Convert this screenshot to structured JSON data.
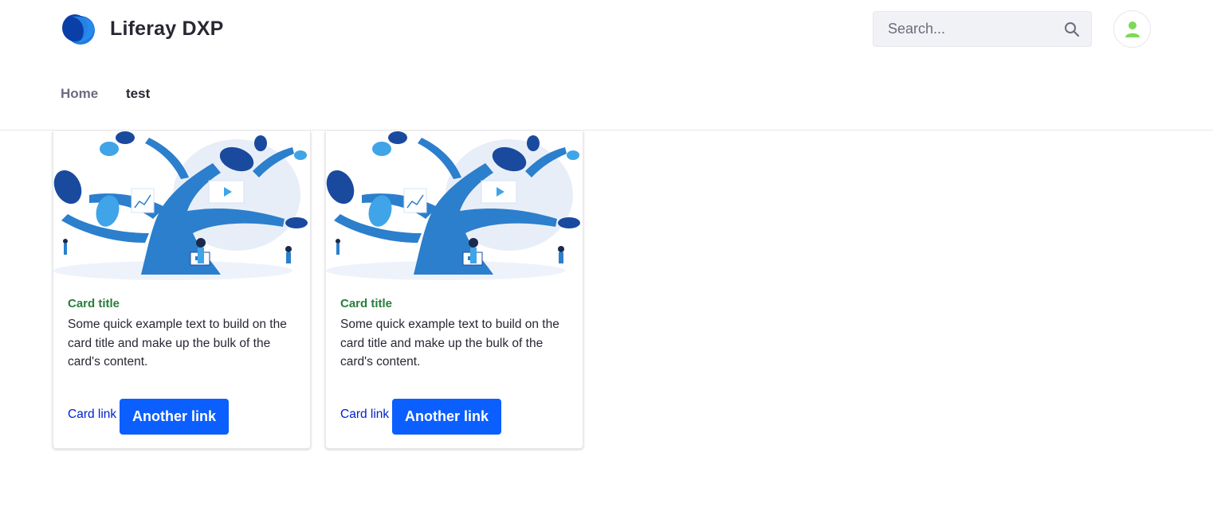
{
  "header": {
    "site_name": "Liferay DXP",
    "logo_icon": "liferay-logo-icon",
    "search": {
      "placeholder": "Search...",
      "icon": "search-icon"
    },
    "user_icon": "user-avatar-icon"
  },
  "nav": {
    "items": [
      {
        "label": "Home"
      },
      {
        "label": "test"
      }
    ]
  },
  "cards": [
    {
      "image": "tree-illustration",
      "title": "Card title",
      "text": "Some quick example text to build on the card title and make up the bulk of the card's content.",
      "link_label": "Card link",
      "button_label": "Another link"
    },
    {
      "image": "tree-illustration",
      "title": "Card title",
      "text": "Some quick example text to build on the card title and make up the bulk of the card's content.",
      "link_label": "Card link",
      "button_label": "Another link"
    }
  ],
  "colors": {
    "primary": "#0b5fff",
    "title_green": "#287d3c",
    "logo_blue": "#0b5fff",
    "avatar_green": "#7ed957"
  }
}
